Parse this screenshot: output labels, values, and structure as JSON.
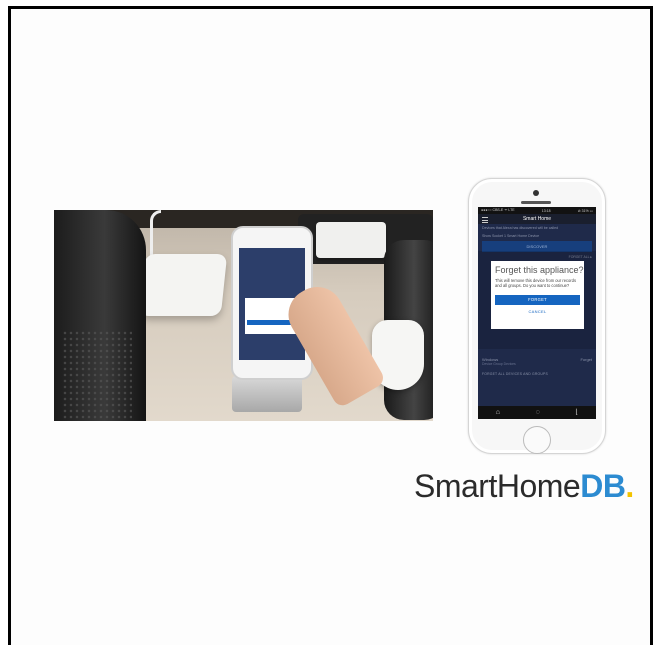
{
  "phone": {
    "status_left": "●●●○○ CBS-E ᯤ LTE",
    "status_time": "13:18",
    "status_right": "⊘ 31% ▭",
    "app_title": "Smart Home",
    "bg_line1": "Devices that Alexa has discovered will be called",
    "bg_line2": "Show Socket 1 Smart Home Device",
    "discover_label": "DISCOVER",
    "forget_all_right": "FORGET ALL ▸",
    "dialog_title": "Forget this appliance?",
    "dialog_message": "This will remove this device from our records and all groups. Do you want to continue?",
    "forget_button": "FORGET",
    "cancel_button": "CANCEL",
    "device_name": "Windows",
    "device_action": "Forget",
    "device_sub": "Device Group Devices",
    "forget_all_footer": "FORGET ALL DEVICES AND GROUPS",
    "tabs": [
      "⌂",
      "◌",
      "⌊"
    ]
  },
  "logo": {
    "text_plain": "SmartHome",
    "text_bold": "DB",
    "text_dot": ".",
    "accent_blue": "#2c8bd1",
    "accent_yellow": "#f2c300"
  },
  "icons": {
    "photo": "photo-of-echo-hub-phone-and-lamp",
    "menu": "hamburger-menu-icon",
    "home": "home-tab-icon",
    "chat": "chat-tab-icon",
    "settings": "settings-tab-icon"
  }
}
